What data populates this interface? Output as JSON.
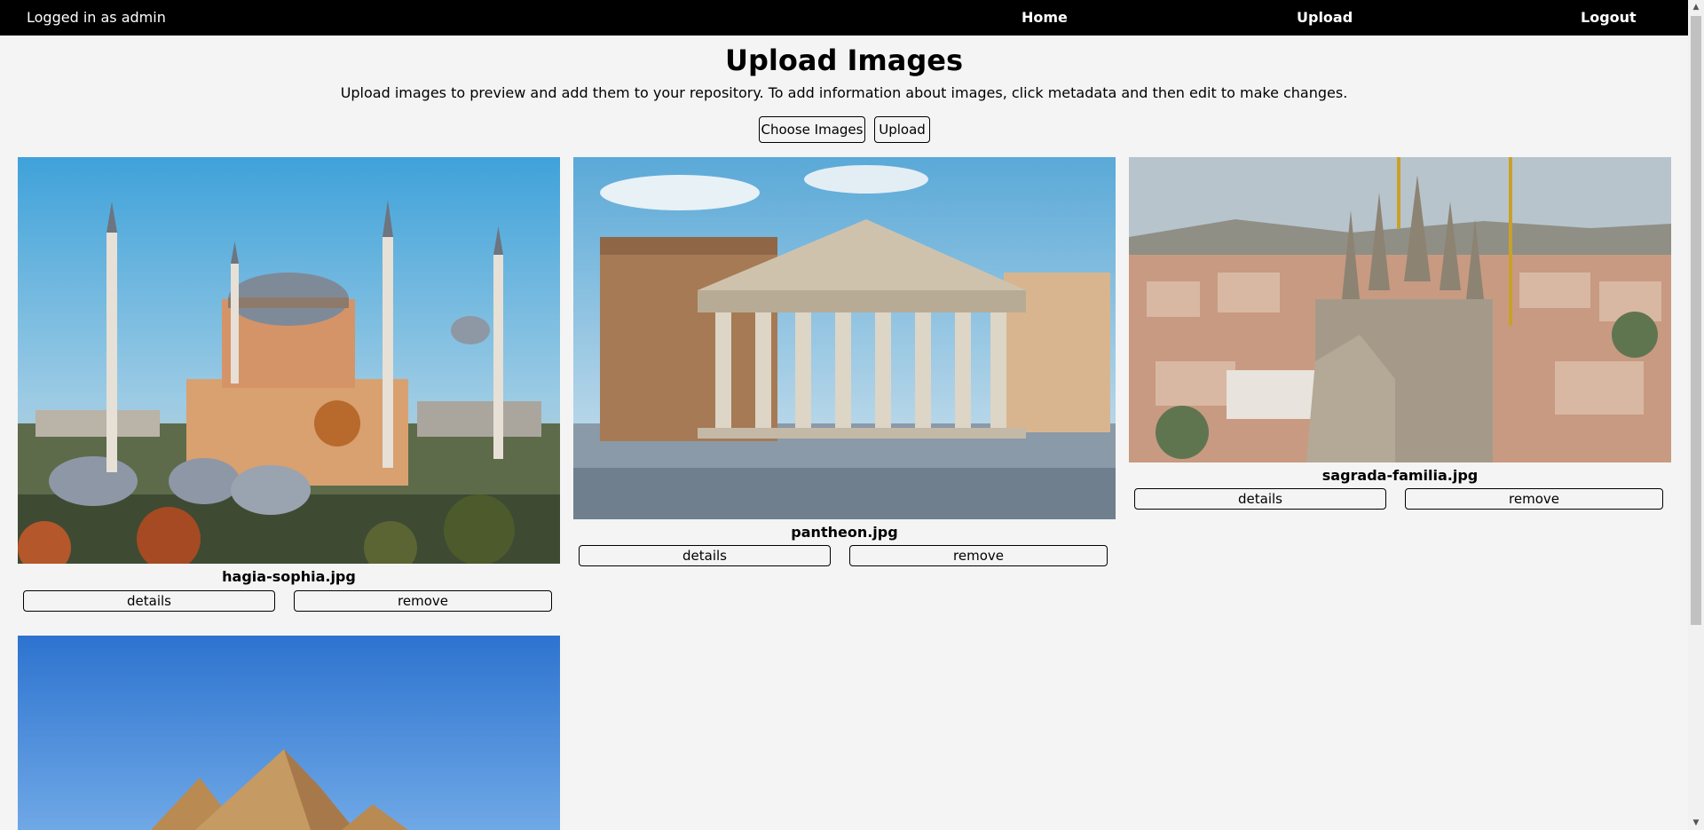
{
  "nav": {
    "user_text": "Logged in as admin",
    "home": "Home",
    "upload": "Upload",
    "logout": "Logout"
  },
  "header": {
    "title": "Upload Images",
    "description": "Upload images to preview and add them to your repository. To add information about images, click metadata and then edit to make changes.",
    "choose_label": "Choose Images",
    "upload_label": "Upload"
  },
  "images": [
    {
      "filename": "hagia-sophia.jpg",
      "details_label": "details",
      "remove_label": "remove"
    },
    {
      "filename": "pantheon.jpg",
      "details_label": "details",
      "remove_label": "remove"
    },
    {
      "filename": "sagrada-familia.jpg",
      "details_label": "details",
      "remove_label": "remove"
    }
  ],
  "colors": {
    "navbar": "#000000",
    "page_background": "#f4f4f4"
  }
}
